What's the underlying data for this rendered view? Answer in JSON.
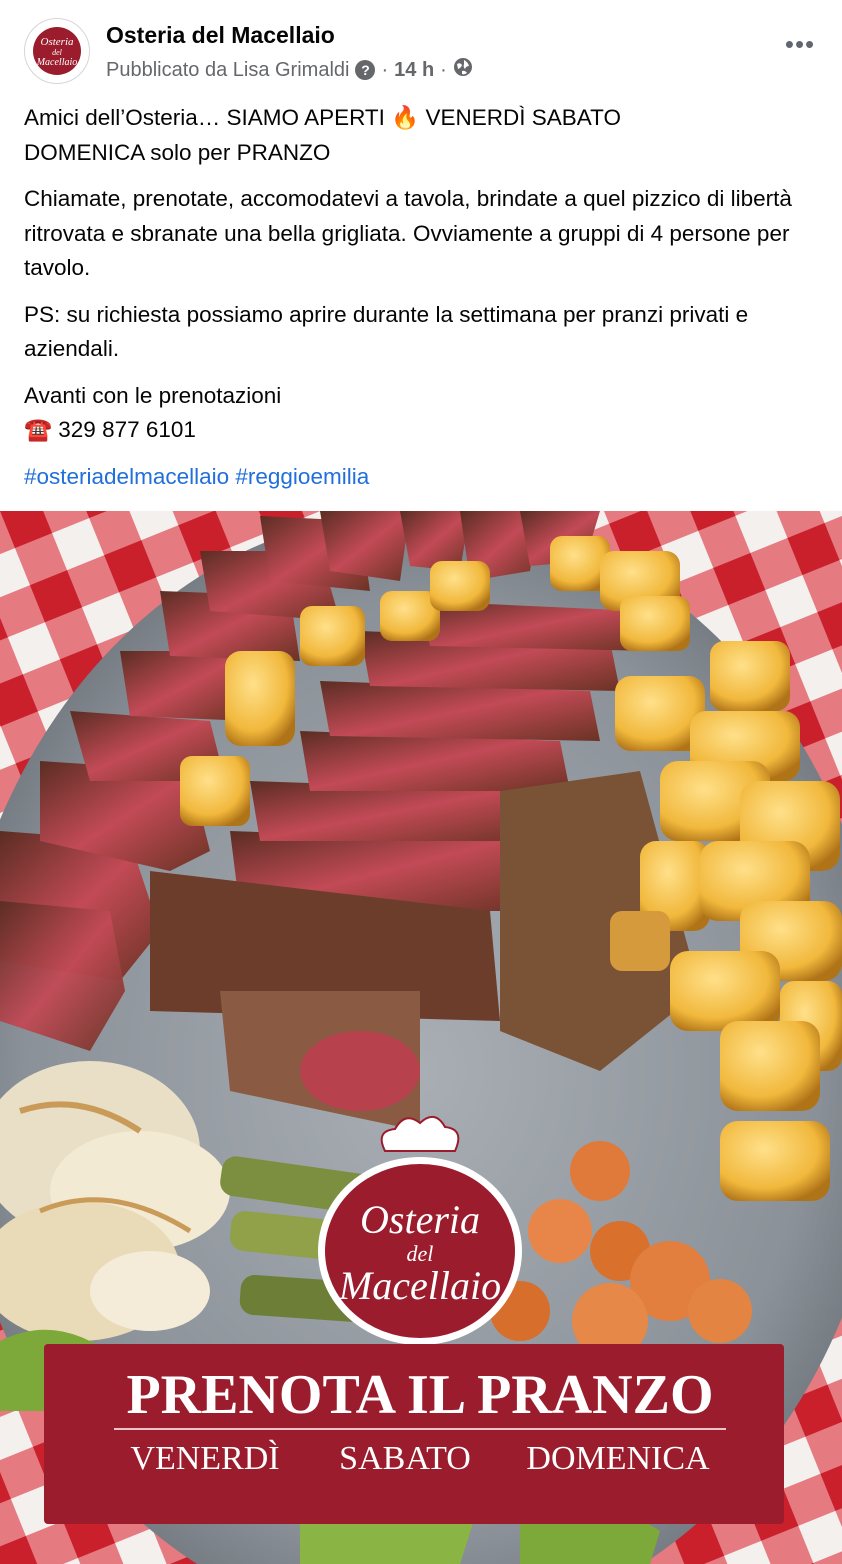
{
  "post": {
    "page_name": "Osteria del Macellaio",
    "published_by": "Pubblicato da Lisa Grimaldi",
    "help_icon_glyph": "?",
    "time": "14 h",
    "separator": "·",
    "privacy_icon": "globe-icon",
    "more_icon": "more-options-icon",
    "more_glyph": "•••",
    "avatar_text": [
      "Osteria",
      "del",
      "Macellaio"
    ],
    "paragraphs": [
      {
        "line1": "Amici dell’Osteria… SIAMO APERTI",
        "emoji": "🔥",
        "line2": " VENERDÌ SABATO",
        "line3": "DOMENICA solo per PRANZO"
      },
      {
        "text": "Chiamate, prenotate, accomodatevi a tavola, brindate a quel pizzico di libertà ritrovata e sbranate una bella grigliata. Ovviamente a gruppi di 4 persone per tavolo."
      },
      {
        "text": "PS: su richiesta possiamo aprire durante la settimana per pranzi privati e aziendali."
      },
      {
        "line1": "Avanti con le prenotazioni",
        "phone_emoji": "☎️",
        "phone": "329 877 6101"
      }
    ],
    "hashtags": [
      "#osteriadelmacellaio",
      "#reggioemilia"
    ]
  },
  "image": {
    "logo_lines": [
      "Osteria",
      "del",
      "Macellaio"
    ],
    "banner_title": "PRENOTA IL PRANZO",
    "banner_days": [
      "VENERDÌ",
      "SABATO",
      "DOMENICA"
    ],
    "colors": {
      "brand_red": "#9b1c2c",
      "check_red": "#d8232e",
      "link_blue": "#216fdb"
    }
  }
}
